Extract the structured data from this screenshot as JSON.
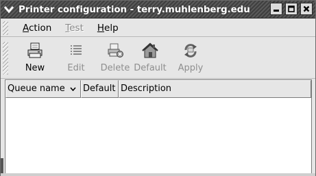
{
  "window": {
    "title": "Printer configuration - terry.muhlenberg.edu"
  },
  "menubar": {
    "items": [
      {
        "pre": "",
        "mnemonic": "A",
        "post": "ction",
        "enabled": true
      },
      {
        "pre": "",
        "mnemonic": "T",
        "post": "est",
        "enabled": false
      },
      {
        "pre": "",
        "mnemonic": "H",
        "post": "elp",
        "enabled": true
      }
    ]
  },
  "toolbar": {
    "buttons": [
      {
        "label": "New",
        "icon": "printer-new-icon",
        "enabled": true
      },
      {
        "label": "Edit",
        "icon": "edit-list-icon",
        "enabled": false
      },
      {
        "label": "Delete",
        "icon": "printer-delete-icon",
        "enabled": false
      },
      {
        "label": "Default",
        "icon": "home-default-icon",
        "enabled": false
      },
      {
        "label": "Apply",
        "icon": "apply-refresh-icon",
        "enabled": false
      }
    ]
  },
  "queue_list": {
    "columns": [
      "Queue name",
      "Default",
      "Description"
    ],
    "rows": []
  }
}
